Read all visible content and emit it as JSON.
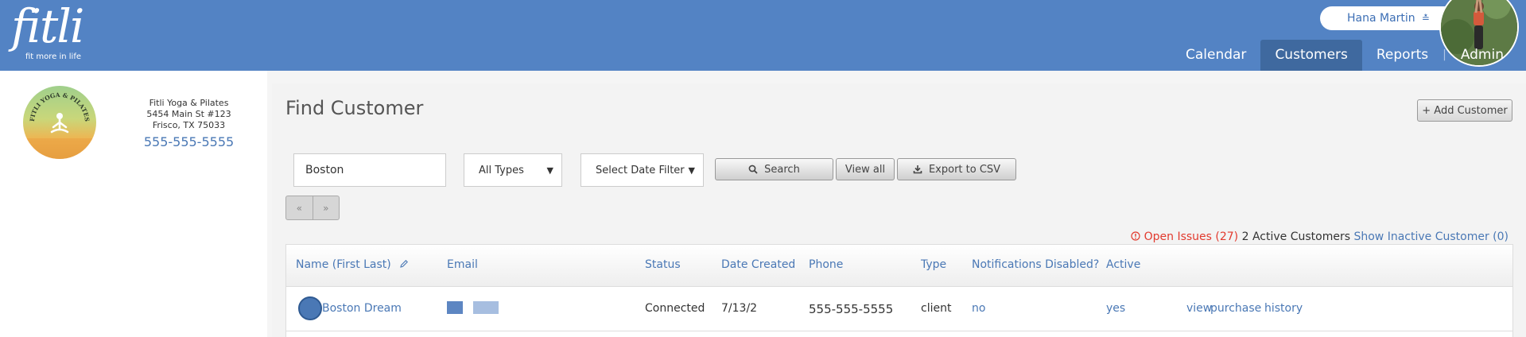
{
  "header": {
    "logo_text": "fitli",
    "logo_tagline": "fit more in life",
    "user_name": "Hana Martin",
    "nav": [
      {
        "label": "Calendar",
        "active": false
      },
      {
        "label": "Customers",
        "active": true
      },
      {
        "label": "Reports",
        "active": false
      },
      {
        "label": "Admin",
        "active": false
      }
    ]
  },
  "business": {
    "logo_text": "FITLI YOGA & PILATES",
    "name": "Fitli Yoga & Pilates",
    "address1": "5454 Main St #123",
    "address2": "Frisco, TX 75033",
    "phone": "555-555-5555"
  },
  "page": {
    "title": "Find Customer",
    "add_label": "+ Add Customer"
  },
  "filters": {
    "search_value": "Boston",
    "type_selected": "All Types",
    "date_selected": "Select Date Filter",
    "search_label": "Search",
    "viewall_label": "View all",
    "export_label": "Export to CSV",
    "pager_prev": "«",
    "pager_next": "»"
  },
  "summary": {
    "issues_label": "Open Issues (27)",
    "active_label": "2 Active Customers",
    "inactive_label": "Show Inactive Customer (0)"
  },
  "table": {
    "columns": [
      "Name (First Last)",
      "Email",
      "Status",
      "Date Created",
      "Phone",
      "Type",
      "Notifications Disabled?",
      "Active"
    ],
    "rows": [
      {
        "name": "Boston Dream",
        "status": "Connected",
        "date_created": "7/13/2",
        "phone": "555-555-5555",
        "type": "client",
        "notifications_disabled": "no",
        "active": "yes",
        "actions": [
          "view",
          "purchase",
          "history"
        ]
      }
    ]
  },
  "colors": {
    "header_bg": "#5383c4",
    "nav_active_bg": "#3f699f",
    "link": "#4a78b5",
    "issue_red": "#e23a2e"
  },
  "icons": {
    "user_menu": "chevron-down-icon",
    "edit_column": "pencil-icon",
    "search_button": "search-icon",
    "export_button": "download-icon",
    "open_issues": "alert-circle-icon"
  }
}
